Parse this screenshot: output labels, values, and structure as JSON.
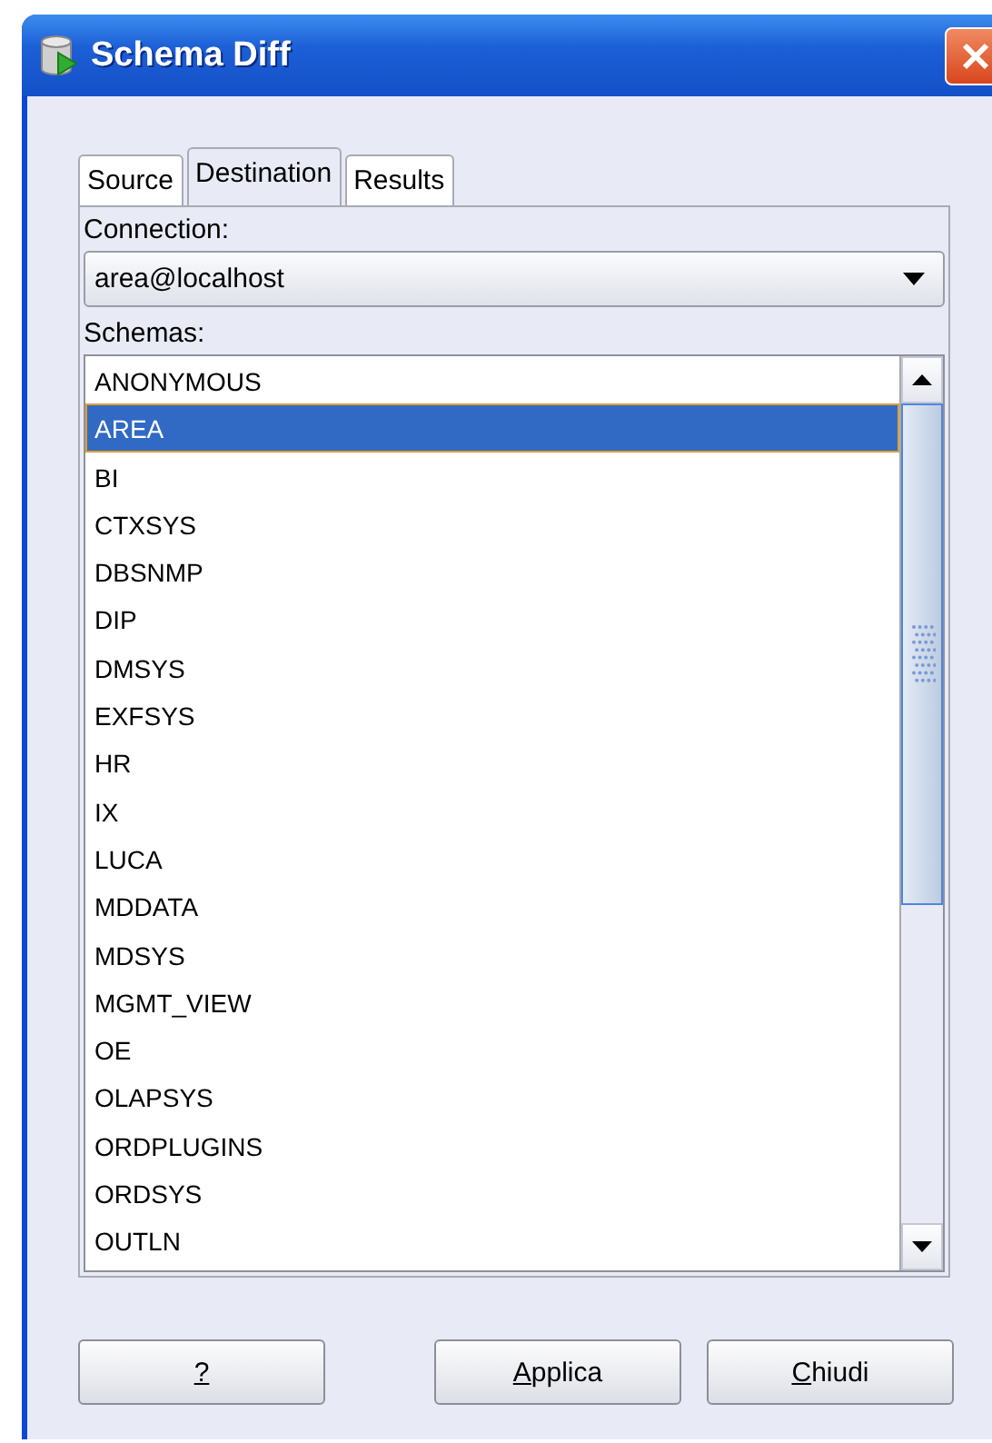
{
  "window": {
    "title": "Schema Diff"
  },
  "tabs": [
    {
      "label": "Source",
      "selected": false
    },
    {
      "label": "Destination",
      "selected": true
    },
    {
      "label": "Results",
      "selected": false
    }
  ],
  "connection": {
    "label": "Connection:",
    "value": "area@localhost"
  },
  "schemas": {
    "label": "Schemas:",
    "items": [
      {
        "label": "ANONYMOUS",
        "selected": false
      },
      {
        "label": "AREA",
        "selected": true
      },
      {
        "label": "BI",
        "selected": false
      },
      {
        "label": "CTXSYS",
        "selected": false
      },
      {
        "label": "DBSNMP",
        "selected": false
      },
      {
        "label": "DIP",
        "selected": false
      },
      {
        "label": "DMSYS",
        "selected": false
      },
      {
        "label": "EXFSYS",
        "selected": false
      },
      {
        "label": "HR",
        "selected": false
      },
      {
        "label": "IX",
        "selected": false
      },
      {
        "label": "LUCA",
        "selected": false
      },
      {
        "label": "MDDATA",
        "selected": false
      },
      {
        "label": "MDSYS",
        "selected": false
      },
      {
        "label": "MGMT_VIEW",
        "selected": false
      },
      {
        "label": "OE",
        "selected": false
      },
      {
        "label": "OLAPSYS",
        "selected": false
      },
      {
        "label": "ORDPLUGINS",
        "selected": false
      },
      {
        "label": "ORDSYS",
        "selected": false
      },
      {
        "label": "OUTLN",
        "selected": false
      }
    ]
  },
  "buttons": [
    {
      "parts": [
        {
          "text": "?",
          "underlined": true
        }
      ]
    },
    {
      "parts": [
        {
          "text": "A",
          "underlined": true
        },
        {
          "text": "pplica",
          "underlined": false
        }
      ]
    },
    {
      "parts": [
        {
          "text": "C",
          "underlined": true
        },
        {
          "text": "hiudi",
          "underlined": false
        }
      ]
    }
  ]
}
